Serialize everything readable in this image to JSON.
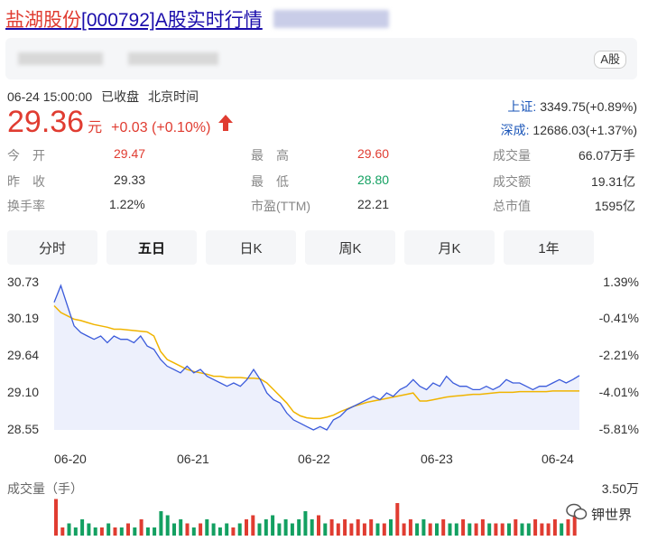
{
  "header": {
    "stock_name": "盐湖股份",
    "code_title": "[000792]A股实时行情",
    "market_badge": "A股"
  },
  "quote": {
    "timestamp": "06-24 15:00:00",
    "status": "已收盘",
    "timezone": "北京时间",
    "price": "29.36",
    "unit": "元",
    "change": "+0.03 (+0.10%)",
    "arrow": "🡅"
  },
  "indices": [
    {
      "label": "上证:",
      "value": "3349.75(+0.89%)"
    },
    {
      "label": "深成:",
      "value": "12686.03(+1.37%)"
    }
  ],
  "stats": [
    {
      "key": "今　开",
      "value": "29.47",
      "color": "red"
    },
    {
      "key": "最　高",
      "value": "29.60",
      "color": "red"
    },
    {
      "key": "成交量",
      "value": "66.07万手",
      "color": "normal"
    },
    {
      "key": "昨　收",
      "value": "29.33",
      "color": "normal"
    },
    {
      "key": "最　低",
      "value": "28.80",
      "color": "green"
    },
    {
      "key": "成交额",
      "value": "19.31亿",
      "color": "normal"
    },
    {
      "key": "换手率",
      "value": "1.22%",
      "color": "normal"
    },
    {
      "key": "市盈(TTM)",
      "value": "22.21",
      "color": "normal"
    },
    {
      "key": "总市值",
      "value": "1595亿",
      "color": "normal"
    }
  ],
  "tabs": [
    {
      "label": "分时",
      "active": false
    },
    {
      "label": "五日",
      "active": true
    },
    {
      "label": "日K",
      "active": false
    },
    {
      "label": "周K",
      "active": false
    },
    {
      "label": "月K",
      "active": false
    },
    {
      "label": "1年",
      "active": false
    }
  ],
  "watermark": "钾世界",
  "chart_data": {
    "type": "line",
    "yticks_left": [
      "30.73",
      "30.19",
      "29.64",
      "29.10",
      "28.55"
    ],
    "yticks_right": [
      "1.39%",
      "-0.41%",
      "-2.21%",
      "-4.01%",
      "-5.81%"
    ],
    "ylim": [
      28.55,
      30.73
    ],
    "x_labels": [
      "06-20",
      "06-21",
      "06-22",
      "06-23",
      "06-24"
    ],
    "volume_title": "成交量（手）",
    "volume_max_label": "3.50万",
    "colors": {
      "price": "#3b5bdb",
      "avg": "#f0b400",
      "fill": "#e8ecfb",
      "up": "#e03c31",
      "down": "#13a061"
    },
    "series": [
      {
        "values": [
          30.45,
          30.7,
          30.4,
          30.1,
          30.0,
          29.95,
          29.9,
          29.95,
          29.85,
          29.95,
          29.9,
          29.9,
          29.85,
          29.95,
          29.8,
          29.75,
          29.6,
          29.5,
          29.45,
          29.4,
          29.5,
          29.4,
          29.45,
          29.35,
          29.3,
          29.25,
          29.2,
          29.25,
          29.2,
          29.3,
          29.45,
          29.3,
          29.1,
          29.0,
          28.95,
          28.8,
          28.7,
          28.65,
          28.6,
          28.55,
          28.6,
          28.55,
          28.7,
          28.75,
          28.85,
          28.9,
          28.95,
          29.0,
          29.05,
          29.0,
          29.1,
          29.05,
          29.15,
          29.2,
          29.3,
          29.2,
          29.15,
          29.25,
          29.2,
          29.35,
          29.25,
          29.2,
          29.2,
          29.15,
          29.15,
          29.2,
          29.15,
          29.2,
          29.3,
          29.25,
          29.25,
          29.2,
          29.15,
          29.2,
          29.2,
          29.25,
          29.3,
          29.25,
          29.3,
          29.36
        ]
      },
      {
        "values": [
          30.4,
          30.3,
          30.25,
          30.2,
          30.18,
          30.15,
          30.12,
          30.1,
          30.08,
          30.05,
          30.05,
          30.04,
          30.03,
          30.02,
          30.01,
          29.95,
          29.72,
          29.6,
          29.55,
          29.5,
          29.45,
          29.42,
          29.4,
          29.38,
          29.35,
          29.35,
          29.33,
          29.33,
          29.33,
          29.32,
          29.32,
          29.31,
          29.25,
          29.15,
          29.05,
          28.95,
          28.82,
          28.76,
          28.73,
          28.72,
          28.72,
          28.74,
          28.77,
          28.82,
          28.86,
          28.9,
          28.93,
          28.96,
          28.98,
          29.0,
          29.02,
          29.04,
          29.06,
          29.08,
          29.1,
          28.98,
          28.98,
          29.0,
          29.02,
          29.04,
          29.05,
          29.06,
          29.07,
          29.08,
          29.08,
          29.09,
          29.1,
          29.11,
          29.11,
          29.11,
          29.12,
          29.12,
          29.12,
          29.12,
          29.12,
          29.13,
          29.13,
          29.13,
          29.13,
          29.13
        ]
      }
    ],
    "volume": [
      9,
      2,
      3,
      2,
      4,
      3,
      2,
      2,
      3,
      2,
      2,
      3,
      2,
      4,
      2,
      2,
      6,
      5,
      3,
      4,
      3,
      2,
      3,
      4,
      3,
      2,
      3,
      2,
      3,
      4,
      5,
      3,
      4,
      5,
      3,
      4,
      3,
      4,
      6,
      4,
      5,
      3,
      4,
      3,
      4,
      3,
      4,
      3,
      4,
      3,
      3,
      4,
      8,
      3,
      4,
      3,
      4,
      3,
      3,
      4,
      3,
      3,
      4,
      3,
      3,
      4,
      3,
      3,
      3,
      3,
      4,
      3,
      3,
      4,
      3,
      3,
      4,
      3,
      4,
      5
    ]
  }
}
